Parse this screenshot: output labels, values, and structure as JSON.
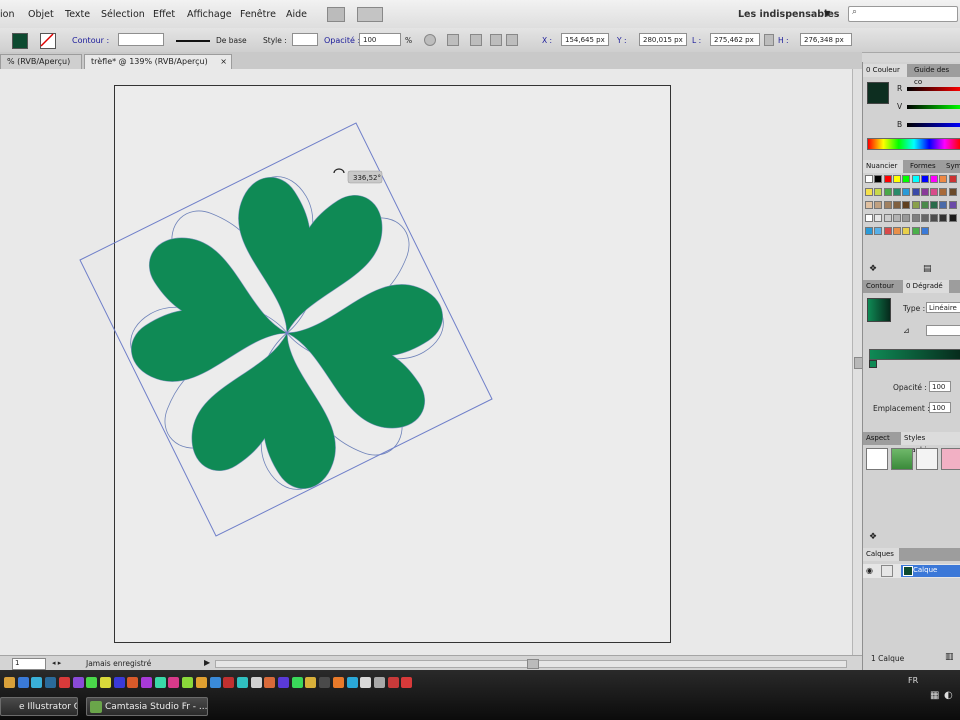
{
  "menu": {
    "items": [
      "ion",
      "Objet",
      "Texte",
      "Sélection",
      "Effet",
      "Affichage",
      "Fenêtre",
      "Aide"
    ],
    "workspace": "Les indispensables"
  },
  "control_bar": {
    "contour_label": "Contour :",
    "stroke_profile": "De base",
    "style_label": "Style :",
    "opacity_label": "Opacité :",
    "opacity_value": "100",
    "opacity_unit": "%",
    "x_label": "X :",
    "x_value": "154,645 px",
    "y_label": "Y :",
    "y_value": "280,015 px",
    "w_label": "L :",
    "w_value": "275,462 px",
    "h_label": "H :",
    "h_value": "276,348 px"
  },
  "tabs": [
    {
      "label": "% (RVB/Aperçu)",
      "active": false
    },
    {
      "label": "trèfle* @ 139% (RVB/Aperçu)",
      "active": true
    }
  ],
  "canvas": {
    "rotation_tooltip": "336,52°",
    "fill_color_dark": "#06291b",
    "fill_color_light": "#0f8a55"
  },
  "status_bar": {
    "zoom": "1",
    "save_state": "Jamais enregistré"
  },
  "panels": {
    "color": {
      "tabs": [
        "0 Couleur",
        "Guide des co"
      ],
      "channels": [
        "R",
        "V",
        "B"
      ]
    },
    "swatches": {
      "tabs": [
        "Nuancier",
        "Formes",
        "Sym"
      ]
    },
    "gradient": {
      "tabs": [
        "Contour",
        "0 Dégradé"
      ],
      "type_label": "Type :",
      "type_value": "Linéaire",
      "opacity_label": "Opacité :",
      "opacity_value": "100",
      "location_label": "Emplacement :",
      "location_value": "100"
    },
    "appearance": {
      "tabs": [
        "Aspect",
        "Styles graphiqu"
      ]
    },
    "layers": {
      "tabs": [
        "Calques"
      ],
      "layer_name": "Calque",
      "count": "1 Calque"
    }
  },
  "taskbar": {
    "buttons": [
      "e Illustrator CS...",
      "Camtasia Studio Fr - ..."
    ],
    "language": "FR"
  }
}
